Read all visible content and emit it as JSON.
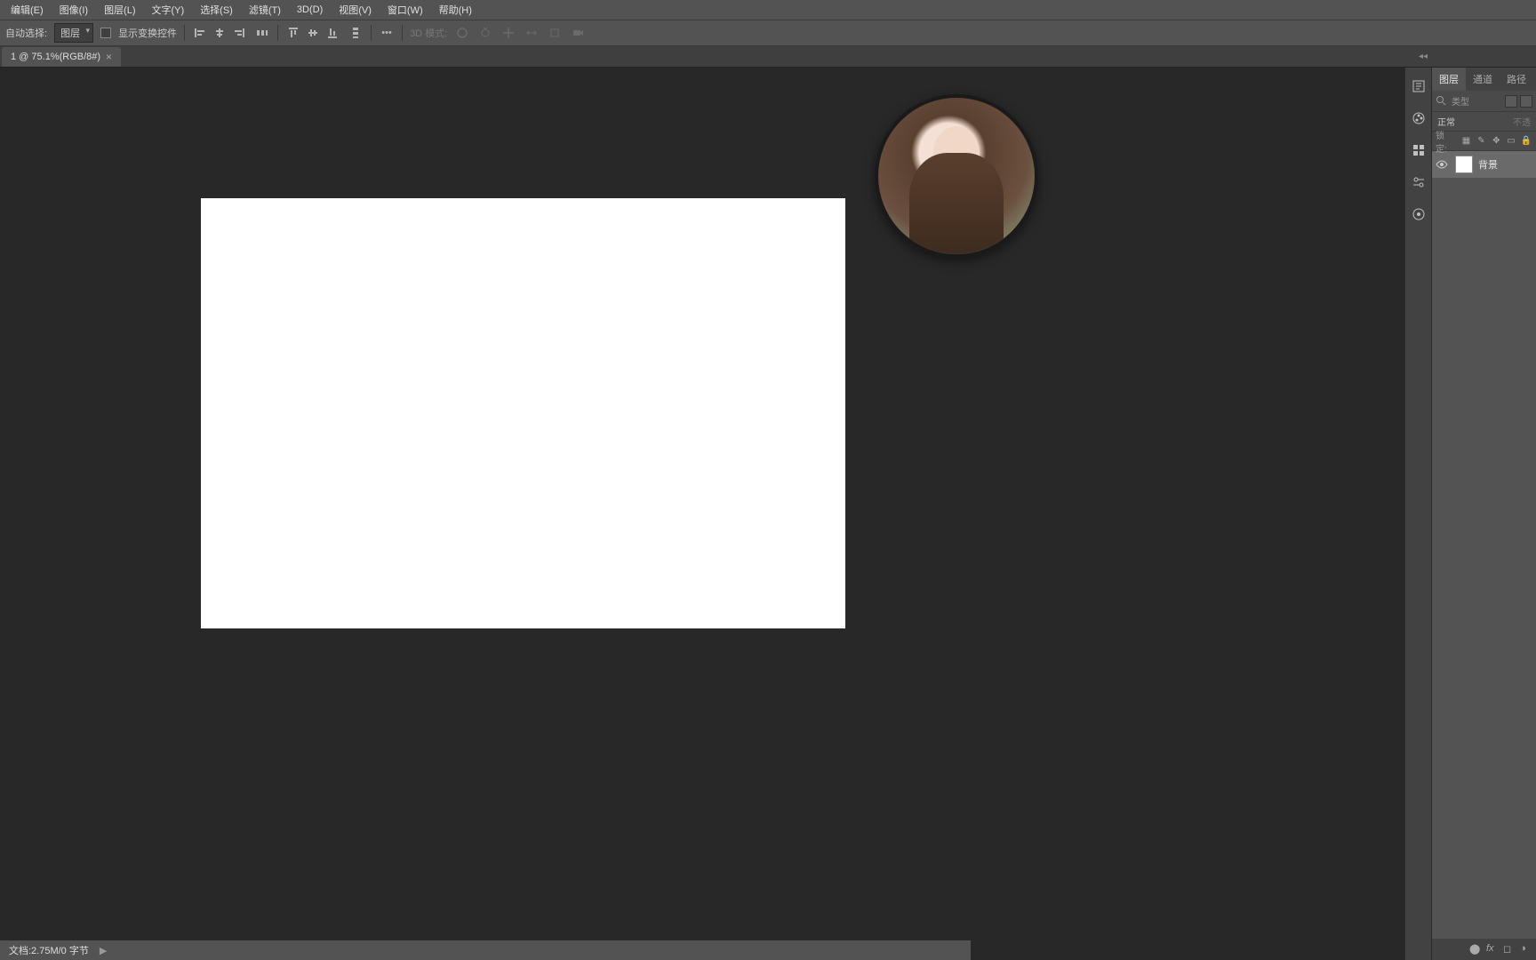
{
  "menu": {
    "items": [
      "编辑(E)",
      "图像(I)",
      "图层(L)",
      "文字(Y)",
      "选择(S)",
      "滤镜(T)",
      "3D(D)",
      "视图(V)",
      "窗口(W)",
      "帮助(H)"
    ]
  },
  "options": {
    "auto_select_label": "自动选择:",
    "auto_select_value": "图层",
    "show_transform_label": "显示变换控件",
    "mode_3d_label": "3D 模式:"
  },
  "tab": {
    "title": "1 @ 75.1%(RGB/8#)"
  },
  "panel_tabs": [
    "图层",
    "通道",
    "路径"
  ],
  "filter": {
    "label": "类型"
  },
  "blend": {
    "mode": "正常",
    "opacity": "不透"
  },
  "lock": {
    "label": "锁定:"
  },
  "layers": [
    {
      "name": "背景",
      "visible": true
    }
  ],
  "status": {
    "doc": "文档:2.75M/0 字节"
  }
}
